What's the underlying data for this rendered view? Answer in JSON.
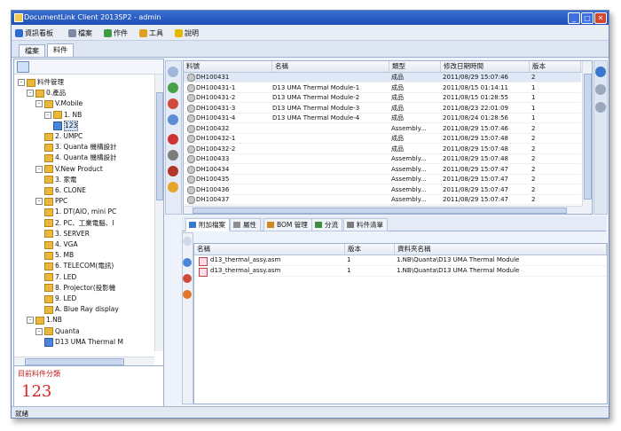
{
  "window": {
    "title": "DocumentLink Client 2013SP2 - admin",
    "controls": [
      "minimize",
      "maximize",
      "close"
    ]
  },
  "menubar": {
    "items": [
      {
        "label": "資訊看板",
        "icon": "dashboard-icon",
        "color": "#2d6bcf"
      },
      {
        "label": "檔案",
        "icon": "file-icon",
        "color": "#7c8aa5"
      },
      {
        "label": "作件",
        "icon": "part-icon",
        "color": "#3f9b3f"
      },
      {
        "label": "工具",
        "icon": "tools-icon",
        "color": "#e0a020"
      },
      {
        "label": "說明",
        "icon": "help-icon",
        "color": "#e6b800"
      }
    ]
  },
  "doc_tabs": [
    {
      "label": "檔案",
      "active": false
    },
    {
      "label": "料件",
      "active": true
    }
  ],
  "tree": {
    "items": [
      {
        "depth": 0,
        "label": "料件管理",
        "type": "folder",
        "expander": "⊟"
      },
      {
        "depth": 1,
        "label": "0.產品",
        "type": "folder",
        "expander": "⊟"
      },
      {
        "depth": 2,
        "label": "V.Mobile",
        "type": "folder",
        "expander": "⊟"
      },
      {
        "depth": 3,
        "label": "1. NB",
        "type": "folder",
        "expander": "⊟"
      },
      {
        "depth": 4,
        "label": "123",
        "type": "doc",
        "selected": true
      },
      {
        "depth": 3,
        "label": "2. UMPC",
        "type": "folder"
      },
      {
        "depth": 3,
        "label": "3. Quanta 機構設計",
        "type": "folder"
      },
      {
        "depth": 3,
        "label": "4. Quanta 機構設計",
        "type": "folder"
      },
      {
        "depth": 2,
        "label": "V.New Product",
        "type": "folder",
        "expander": "⊟"
      },
      {
        "depth": 3,
        "label": "3. 家電",
        "type": "folder"
      },
      {
        "depth": 3,
        "label": "6. CLONE",
        "type": "folder"
      },
      {
        "depth": 2,
        "label": "PPC",
        "type": "folder",
        "expander": "⊟"
      },
      {
        "depth": 3,
        "label": "1. DT(AIO, mini PC",
        "type": "folder"
      },
      {
        "depth": 3,
        "label": "2. PC、工業電腦、I",
        "type": "folder"
      },
      {
        "depth": 3,
        "label": "3. SERVER",
        "type": "folder"
      },
      {
        "depth": 3,
        "label": "4. VGA",
        "type": "folder"
      },
      {
        "depth": 3,
        "label": "5. MB",
        "type": "folder"
      },
      {
        "depth": 3,
        "label": "6. TELECOM(電訊)",
        "type": "folder"
      },
      {
        "depth": 3,
        "label": "7. LED",
        "type": "folder"
      },
      {
        "depth": 3,
        "label": "8. Projector(投影機",
        "type": "folder"
      },
      {
        "depth": 3,
        "label": "9. LED",
        "type": "folder"
      },
      {
        "depth": 3,
        "label": "A. Blue Ray display",
        "type": "folder"
      },
      {
        "depth": 1,
        "label": "1.NB",
        "type": "folder",
        "expander": "⊟"
      },
      {
        "depth": 2,
        "label": "Quanta",
        "type": "folder",
        "expander": "⊟"
      },
      {
        "depth": 3,
        "label": "D13 UMA Thermal M",
        "type": "doc"
      }
    ]
  },
  "recent": {
    "label": "目前料件分類",
    "value": "123"
  },
  "grid": {
    "columns": [
      "料號",
      "名稱",
      "類型",
      "修改日期時間",
      "版本"
    ],
    "rows": [
      {
        "pn": "DH100431",
        "name": "",
        "type": "成品",
        "date": "2011/08/29 15:07:46",
        "ver": "2",
        "selected": true
      },
      {
        "pn": "DH100431-1",
        "name": "D13 UMA Thermal Module-1",
        "type": "成品",
        "date": "2011/08/15 01:14:11",
        "ver": "1"
      },
      {
        "pn": "DH100431-2",
        "name": "D13 UMA Thermal Module-2",
        "type": "成品",
        "date": "2011/08/15 01:28:55",
        "ver": "1"
      },
      {
        "pn": "DH100431-3",
        "name": "D13 UMA Thermal Module-3",
        "type": "成品",
        "date": "2011/08/23 22:01:09",
        "ver": "1"
      },
      {
        "pn": "DH100431-4",
        "name": "D13 UMA Thermal Module-4",
        "type": "成品",
        "date": "2011/08/24 01:28:56",
        "ver": "1"
      },
      {
        "pn": "DH100432",
        "name": "",
        "type": "Assembly...",
        "date": "2011/08/29 15:07:46",
        "ver": "2"
      },
      {
        "pn": "DH100432-1",
        "name": "",
        "type": "成品",
        "date": "2011/08/29 15:07:48",
        "ver": "2"
      },
      {
        "pn": "DH100432-2",
        "name": "",
        "type": "成品",
        "date": "2011/08/29 15:07:48",
        "ver": "2"
      },
      {
        "pn": "DH100433",
        "name": "",
        "type": "Assembly...",
        "date": "2011/08/29 15:07:48",
        "ver": "2"
      },
      {
        "pn": "DH100434",
        "name": "",
        "type": "Assembly...",
        "date": "2011/08/29 15:07:47",
        "ver": "2"
      },
      {
        "pn": "DH100435",
        "name": "",
        "type": "Assembly...",
        "date": "2011/08/29 15:07:47",
        "ver": "2"
      },
      {
        "pn": "DH100436",
        "name": "",
        "type": "Assembly...",
        "date": "2011/08/29 15:07:47",
        "ver": "2"
      },
      {
        "pn": "DH100437",
        "name": "",
        "type": "Assembly...",
        "date": "2011/08/29 15:07:47",
        "ver": "2"
      }
    ]
  },
  "bottom_tabs": [
    {
      "label": "附加檔案",
      "active": true,
      "color": "#3a78d0"
    },
    {
      "label": "屬性",
      "active": false,
      "color": "#8e8e8e"
    },
    {
      "label": "BOM 管理",
      "active": false,
      "color": "#d08a1c"
    },
    {
      "label": "分流",
      "active": false,
      "color": "#3d8f3d"
    },
    {
      "label": "料件清單",
      "active": false,
      "color": "#7d7d7d"
    }
  ],
  "files": {
    "columns": [
      "名稱",
      "版本",
      "資料夾名稱"
    ],
    "rows": [
      {
        "name": "d13_thermal_assy.asm",
        "ver": "1",
        "folder": "1.NB\\Quanta\\D13 UMA Thermal Module"
      },
      {
        "name": "d13_thermal_assy.asm",
        "ver": "1",
        "folder": "1.NB\\Quanta\\D13 UMA Thermal Module"
      }
    ]
  },
  "status": {
    "text": "就緒"
  }
}
